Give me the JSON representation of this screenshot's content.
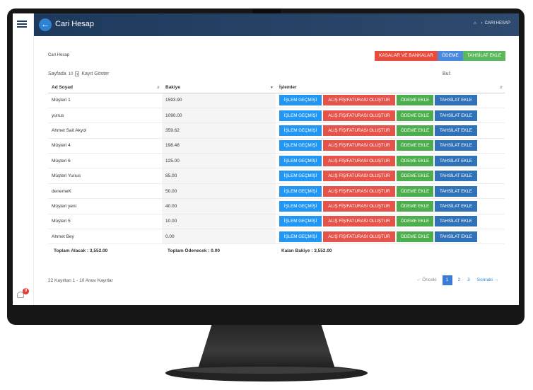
{
  "header": {
    "title": "Cari Hesap",
    "back_icon": "arrow-left-icon",
    "breadcrumb": {
      "home_icon": "home-icon",
      "separator": "›",
      "current": "CARI HESAP"
    }
  },
  "sidebar": {
    "menu_icon": "hamburger-menu-icon",
    "notification_count": "0"
  },
  "content": {
    "section_label": "Cari Hesap",
    "actions": {
      "kasalar": "KASALAR VE BANKALAR",
      "odeme": "ÖDEME",
      "tahsilat": "TAHSİLAT EKLE"
    },
    "length": {
      "prefix": "Sayfada",
      "value": "10",
      "suffix": "Kayıt Göster"
    },
    "search_label": "Bul:",
    "columns": {
      "name": "Ad Soyad",
      "balance": "Bakiye",
      "ops": "İşlemler"
    },
    "op_labels": {
      "history": "İŞLEM GEÇMİŞİ",
      "invoice": "ALIŞ FİŞ/FATURASI OLUŞTUR",
      "payment": "ÖDEME EKLE",
      "collection": "TAHSİLAT EKLE"
    },
    "rows": [
      {
        "name": "Müşteri 1",
        "balance": "1593.90"
      },
      {
        "name": "yunus",
        "balance": "1090.00"
      },
      {
        "name": "Ahmet Sait Akyol",
        "balance": "359.62"
      },
      {
        "name": "Müşteri 4",
        "balance": "198.48"
      },
      {
        "name": "Müşteri 6",
        "balance": "125.00"
      },
      {
        "name": "Müşteri Yunus",
        "balance": "85.00"
      },
      {
        "name": "denemeK",
        "balance": "50.00"
      },
      {
        "name": "Müşteri yeni",
        "balance": "40.00"
      },
      {
        "name": "Müşteri 5",
        "balance": "10.00"
      },
      {
        "name": "Ahmet Bey",
        "balance": "0.00"
      }
    ],
    "totals": {
      "receivable": "Toplam Alacak : 3,552.00",
      "payable": "Toplam Ödenecek : 0.00",
      "remaining": "Kalan Bakiye : 3,552.00"
    },
    "info": "22 Kayıttan 1 - 10 Arası Kayıtlar",
    "pagination": {
      "prev": "← Önceki",
      "pages": [
        "1",
        "2",
        "3"
      ],
      "current": "1",
      "next": "Sonraki →"
    }
  }
}
